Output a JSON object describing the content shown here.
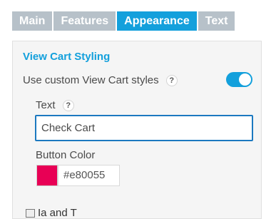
{
  "tabs": [
    {
      "label": "Main",
      "active": false
    },
    {
      "label": "Features",
      "active": false
    },
    {
      "label": "Appearance",
      "active": true
    },
    {
      "label": "Text",
      "active": false
    }
  ],
  "section": {
    "title": "View Cart Styling",
    "custom_styles_label": "Use custom View Cart styles",
    "custom_styles_enabled": true,
    "help_glyph": "?",
    "text_label": "Text",
    "text_value": "Check Cart",
    "button_color_label": "Button Color",
    "button_color_value": "#e80055",
    "cut_off_row_text": "Ia      and T"
  },
  "colors": {
    "accent": "#13a0dc",
    "tab_inactive": "#b7c1c9",
    "swatch": "#e80055"
  }
}
